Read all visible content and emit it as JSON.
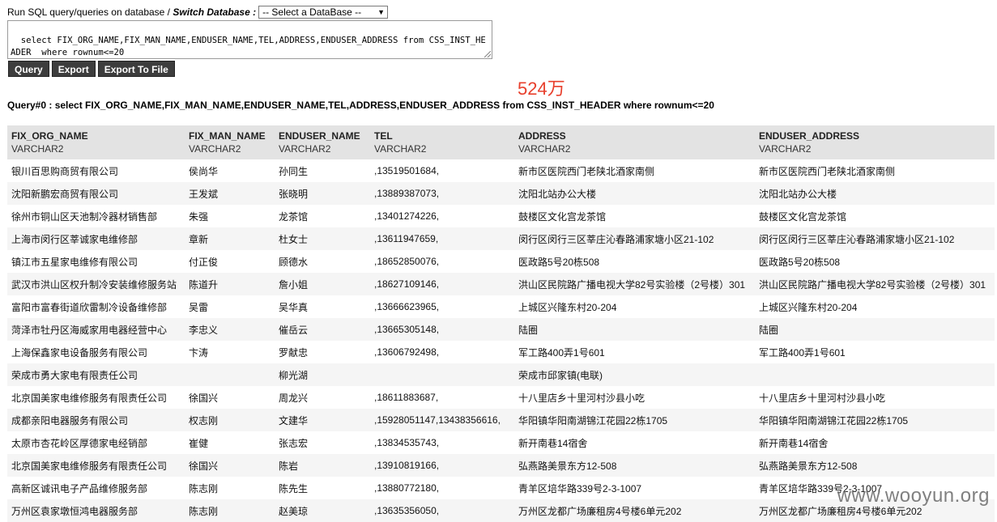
{
  "header": {
    "label_prefix": "Run SQL query/queries on database /",
    "label_switch": "Switch Database :",
    "db_select_value": "-- Select a DataBase --"
  },
  "sql_text": "select FIX_ORG_NAME,FIX_MAN_NAME,ENDUSER_NAME,TEL,ADDRESS,ENDUSER_ADDRESS from CSS_INST_HEADER  where rownum<=20",
  "buttons": {
    "query": "Query",
    "export": "Export",
    "export_file": "Export To File"
  },
  "record_count": "524万",
  "query_title": "Query#0 : select FIX_ORG_NAME,FIX_MAN_NAME,ENDUSER_NAME,TEL,ADDRESS,ENDUSER_ADDRESS from CSS_INST_HEADER where rownum<=20",
  "columns": [
    {
      "name": "FIX_ORG_NAME",
      "type": "VARCHAR2"
    },
    {
      "name": "FIX_MAN_NAME",
      "type": "VARCHAR2"
    },
    {
      "name": "ENDUSER_NAME",
      "type": "VARCHAR2"
    },
    {
      "name": "TEL",
      "type": "VARCHAR2"
    },
    {
      "name": "ADDRESS",
      "type": "VARCHAR2"
    },
    {
      "name": "ENDUSER_ADDRESS",
      "type": "VARCHAR2"
    }
  ],
  "rows": [
    [
      "银川百思购商贸有限公司",
      "侯尚华",
      "孙同生",
      ",13519501684,",
      "新市区医院西门老陕北酒家南侧",
      "新市区医院西门老陕北酒家南侧"
    ],
    [
      "沈阳新鹏宏商贸有限公司",
      "王发斌",
      "张晓明",
      ",13889387073,",
      "沈阳北站办公大楼",
      "沈阳北站办公大楼"
    ],
    [
      "徐州市铜山区天池制冷器材销售部",
      "朱强",
      "龙茶馆",
      ",13401274226,",
      "鼓楼区文化宫龙茶馆",
      "鼓楼区文化宫龙茶馆"
    ],
    [
      "上海市闵行区莘诚家电维修部",
      "章新",
      "杜女士",
      ",13611947659,",
      "闵行区闵行三区莘庄沁春路浦家塘小区21-102",
      "闵行区闵行三区莘庄沁春路浦家塘小区21-102"
    ],
    [
      "镇江市五星家电维修有限公司",
      "付正俊",
      "顾德水",
      ",18652850076,",
      "医政路5号20栋508",
      "医政路5号20栋508"
    ],
    [
      "武汉市洪山区权升制冷安装维修服务站",
      "陈道升",
      "詹小姐",
      ",18627109146,",
      "洪山区民院路广播电视大学82号实验楼（2号楼）301",
      "洪山区民院路广播电视大学82号实验楼（2号楼）301"
    ],
    [
      "富阳市富春街道欣雷制冷设备维修部",
      "吴雷",
      "吴华真",
      ",13666623965,",
      "上城区兴隆东村20-204",
      "上城区兴隆东村20-204"
    ],
    [
      "菏泽市牡丹区海威家用电器经营中心",
      "李忠义",
      "催岳云",
      ",13665305148,",
      "陆圈",
      "陆圈"
    ],
    [
      "上海保鑫家电设备服务有限公司",
      "卞涛",
      "罗献忠",
      ",13606792498,",
      "军工路400弄1号601",
      "军工路400弄1号601"
    ],
    [
      "荣成市勇大家电有限责任公司",
      "",
      "柳光湖",
      "",
      "荣成市邱家镇(电联)",
      ""
    ],
    [
      "北京国美家电维修服务有限责任公司",
      "徐国兴",
      "周龙兴",
      ",18611883687,",
      "十八里店乡十里河村沙县小吃",
      "十八里店乡十里河村沙县小吃"
    ],
    [
      "成都亲阳电器服务有限公司",
      "权志刚",
      "文建华",
      ",15928051147,13438356616,",
      "华阳镇华阳南湖锦江花园22栋1705",
      "华阳镇华阳南湖锦江花园22栋1705"
    ],
    [
      "太原市杏花岭区厚德家电经销部",
      "崔健",
      "张志宏",
      ",13834535743,",
      "新开南巷14宿舍",
      "新开南巷14宿舍"
    ],
    [
      "北京国美家电维修服务有限责任公司",
      "徐国兴",
      "陈岩",
      ",13910819166,",
      "弘燕路美景东方12-508",
      "弘燕路美景东方12-508"
    ],
    [
      "高新区诚讯电子产品维修服务部",
      "陈志刚",
      "陈先生",
      ",13880772180,",
      "青羊区培华路339号2-3-1007",
      "青羊区培华路339号2-3-1007"
    ],
    [
      "万州区袁家墩恒鸿电器服务部",
      "陈志刚",
      "赵美琼",
      ",13635356050,",
      "万州区龙都广场廉租房4号楼6单元202",
      "万州区龙都广场廉租房4号楼6单元202"
    ]
  ],
  "watermark": "www.wooyun.org"
}
